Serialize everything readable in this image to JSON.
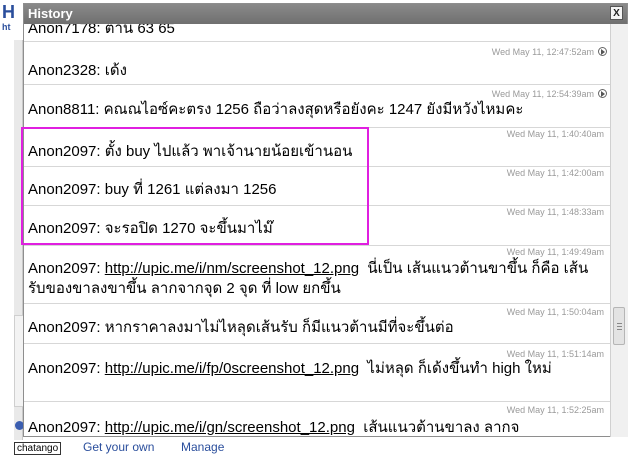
{
  "background": {
    "letter": "H",
    "small_text": "ht",
    "footer": {
      "brand": "chatango",
      "get_your_own": "Get your own",
      "manage": "Manage"
    }
  },
  "window": {
    "title": "History",
    "close_label": "X"
  },
  "messages": [
    {
      "user": "Anon7178",
      "text": "ต้าน 63 65",
      "time": ""
    },
    {
      "user": "Anon2328",
      "text": "เด้ง",
      "time": "Wed May 11, 12:47:52am"
    },
    {
      "user": "Anon8811",
      "text": "คณณไอซ์คะตรง 1256 ถือว่าลงสุดหรือยังคะ 1247 ยังมีหวังไหมคะ",
      "time": "Wed May 11, 12:54:39am"
    },
    {
      "user": "Anon2097",
      "text": "ตั้ง buy ไปแล้ว พาเจ้านายน้อยเข้านอน",
      "time": "Wed May 11, 1:40:40am"
    },
    {
      "user": "Anon2097",
      "text": "buy ที่ 1261 แต่ลงมา 1256",
      "time": "Wed May 11, 1:42:00am"
    },
    {
      "user": "Anon2097",
      "text": "จะรอปิด 1270 จะขึ้นมาไม๊",
      "time": "Wed May 11, 1:48:33am"
    },
    {
      "user": "Anon2097",
      "link": "http://upic.me/i/nm/screenshot_12.png",
      "text": "นี่เป็น เส้นแนวต้านขาขึ้น ก็คือ  เส้นรับของขาลงขาขึ้น ลากจากจุด 2 จุด ที่ low ยกขึ้น",
      "time": "Wed May 11, 1:49:49am"
    },
    {
      "user": "Anon2097",
      "text": "หากราคาลงมาไม่ไหลุดเส้นรับ ก็มีแนวต้านมีที่จะขึ้นต่อ",
      "time": "Wed May 11, 1:50:04am"
    },
    {
      "user": "Anon2097",
      "link": "http://upic.me/i/fp/0screenshot_12.png",
      "text": "ไม่หลุด ก็เด้งขึ้นทำ high ใหม่",
      "time": "Wed May 11, 1:51:14am"
    },
    {
      "user": "Anon2097",
      "link": "http://upic.me/i/gn/screenshot_12.png",
      "text": "เส้นแนวต้านขาลง  ลากจ",
      "time": "Wed May 11, 1:52:25am"
    }
  ]
}
